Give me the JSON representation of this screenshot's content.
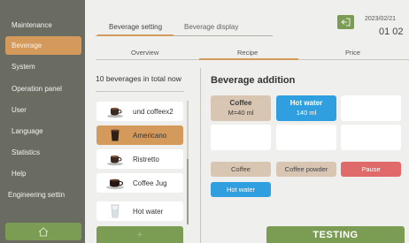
{
  "sidebar": {
    "items": [
      {
        "label": "Maintenance"
      },
      {
        "label": "Beverage"
      },
      {
        "label": "System"
      },
      {
        "label": "Operation panel"
      },
      {
        "label": "User"
      },
      {
        "label": "Language"
      },
      {
        "label": "Statistics"
      },
      {
        "label": "Help"
      },
      {
        "label": "Engineering settin"
      }
    ],
    "active": "Beverage"
  },
  "header": {
    "tabs": [
      {
        "label": "Beverage setting"
      },
      {
        "label": "Beverage display"
      }
    ],
    "date": "2023/02/21",
    "time": "01 02"
  },
  "subtabs": [
    {
      "label": "Overview"
    },
    {
      "label": "Recipe"
    },
    {
      "label": "Price"
    }
  ],
  "beverage_list": {
    "count_label": "10 beverages in total now",
    "items": [
      {
        "label": "und coffeex2",
        "icon": "espresso-cup-icon"
      },
      {
        "label": "Americano",
        "icon": "americano-cup-icon"
      },
      {
        "label": "Ristretto",
        "icon": "espresso-cup-icon"
      },
      {
        "label": "Coffee Jug",
        "icon": "coffee-jug-icon"
      },
      {
        "label": "Hot water",
        "icon": "water-glass-icon"
      }
    ],
    "selected": "Americano",
    "add_label": "+"
  },
  "addition": {
    "title": "Beverage addition",
    "slots": [
      {
        "name": "Coffee",
        "amount": "M=40 ml",
        "type": "coffee"
      },
      {
        "name": "Hot water",
        "amount": "140 ml",
        "type": "water"
      },
      {
        "name": "",
        "amount": "",
        "type": "empty"
      },
      {
        "name": "",
        "amount": "",
        "type": "empty"
      },
      {
        "name": "",
        "amount": "",
        "type": "empty"
      },
      {
        "name": "",
        "amount": "",
        "type": "empty"
      }
    ],
    "ingredients": {
      "coffee": "Coffee",
      "coffee_powder": "Coffee powder",
      "pause": "Pause",
      "hot_water": "Hot water"
    },
    "testing_label": "TESTING"
  },
  "colors": {
    "sidebar_bg": "#6a6b61",
    "accent_orange": "#d49a5c",
    "accent_green": "#7b9c53",
    "water_blue": "#2f9fe0",
    "coffee_beige": "#d8c6b3",
    "pause_red": "#e06a6a"
  }
}
